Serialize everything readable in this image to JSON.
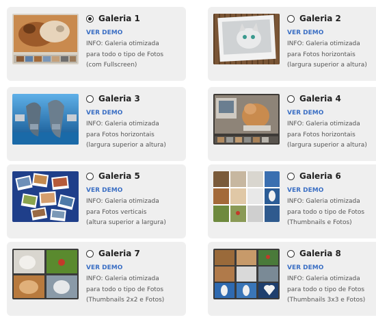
{
  "galleries": [
    {
      "title": "Galeria 1",
      "selected": true,
      "demo": "VER DEMO",
      "info": [
        "INFO: Galeria otimizada",
        "para todo o tipo de Fotos",
        "(com Fullscreen)"
      ],
      "thumbnail": "fullscreen-slider-dog-cat"
    },
    {
      "title": "Galeria 2",
      "selected": false,
      "demo": "VER DEMO",
      "info": [
        "INFO: Galeria otimizada",
        "para Fotos horizontais",
        "(largura superior a altura)"
      ],
      "thumbnail": "polaroid-cat"
    },
    {
      "title": "Galeria 3",
      "selected": false,
      "demo": "VER DEMO",
      "info": [
        "INFO: Galeria otimizada",
        "para Fotos horizontais",
        "(largura superior a altura)"
      ],
      "thumbnail": "dolphins-carousel"
    },
    {
      "title": "Galeria 4",
      "selected": false,
      "demo": "VER DEMO",
      "info": [
        "INFO: Galeria otimizada",
        "para Fotos horizontais",
        "(largura superior a altura)"
      ],
      "thumbnail": "dog-computer"
    },
    {
      "title": "Galeria 5",
      "selected": false,
      "demo": "VER DEMO",
      "info": [
        "INFO: Galeria otimizada",
        "para Fotos verticais",
        "(altura superior a largura)"
      ],
      "thumbnail": "scattered-photos"
    },
    {
      "title": "Galeria 6",
      "selected": false,
      "demo": "VER DEMO",
      "info": [
        "INFO: Galeria otimizada",
        "para todo o tipo de Fotos",
        "(Thumbnails e Fotos)"
      ],
      "thumbnail": "thumbnail-grid"
    },
    {
      "title": "Galeria 7",
      "selected": false,
      "demo": "VER DEMO",
      "info": [
        "INFO: Galeria otimizada",
        "para todo o tipo de Fotos",
        "(Thumbnails 2x2 e Fotos)"
      ],
      "thumbnail": "grid-2x2"
    },
    {
      "title": "Galeria 8",
      "selected": false,
      "demo": "VER DEMO",
      "info": [
        "INFO: Galeria otimizada",
        "para todo o tipo de Fotos",
        "(Thumbnails 3x3 e Fotos)"
      ],
      "thumbnail": "grid-3x3"
    }
  ]
}
